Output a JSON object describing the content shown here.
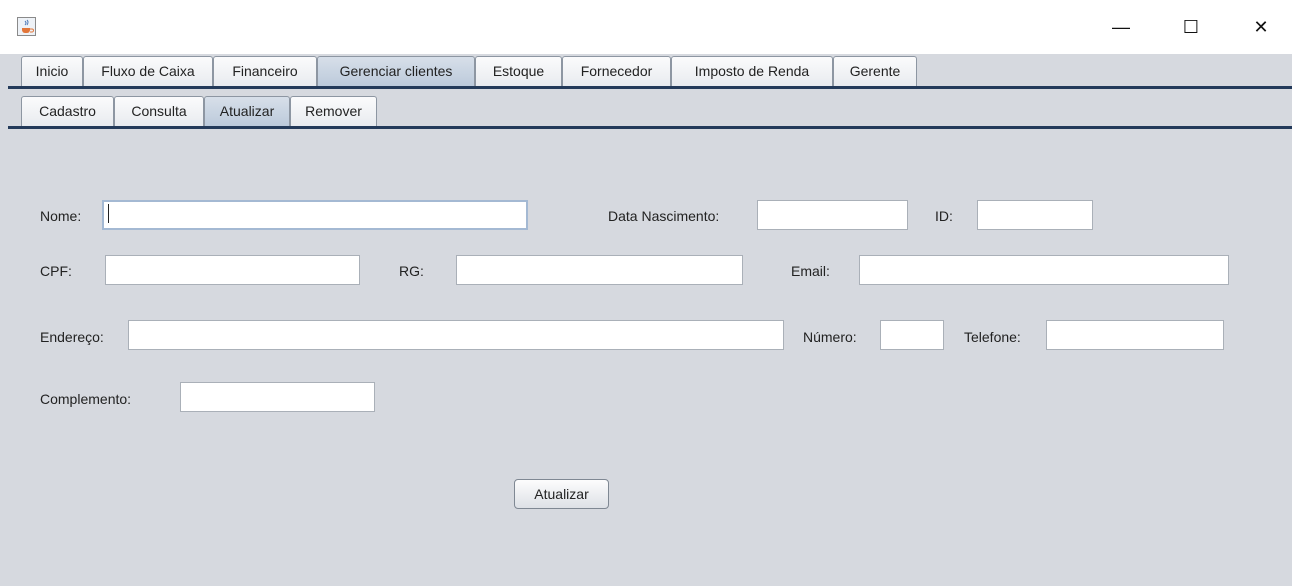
{
  "window": {
    "icon": "java-cup-icon",
    "controls": {
      "minimize": "—",
      "maximize": "☐",
      "close": "✕"
    }
  },
  "main_tabs": [
    {
      "label": "Inicio"
    },
    {
      "label": "Fluxo de Caixa"
    },
    {
      "label": "Financeiro"
    },
    {
      "label": "Gerenciar clientes"
    },
    {
      "label": "Estoque"
    },
    {
      "label": "Fornecedor"
    },
    {
      "label": "Imposto de Renda"
    },
    {
      "label": "Gerente"
    }
  ],
  "main_tabs_selected": "Gerenciar clientes",
  "sub_tabs": [
    {
      "label": "Cadastro"
    },
    {
      "label": "Consulta"
    },
    {
      "label": "Atualizar"
    },
    {
      "label": "Remover"
    }
  ],
  "sub_tabs_selected": "Atualizar",
  "form": {
    "nome": {
      "label": "Nome:",
      "value": ""
    },
    "data_nascimento": {
      "label": "Data Nascimento:",
      "value": ""
    },
    "id": {
      "label": "ID:",
      "value": ""
    },
    "cpf": {
      "label": "CPF:",
      "value": ""
    },
    "rg": {
      "label": "RG:",
      "value": ""
    },
    "email": {
      "label": "Email:",
      "value": ""
    },
    "endereco": {
      "label": "Endereço:",
      "value": ""
    },
    "numero": {
      "label": "Número:",
      "value": ""
    },
    "telefone": {
      "label": "Telefone:",
      "value": ""
    },
    "complemento": {
      "label": "Complemento:",
      "value": ""
    },
    "submit_label": "Atualizar"
  }
}
